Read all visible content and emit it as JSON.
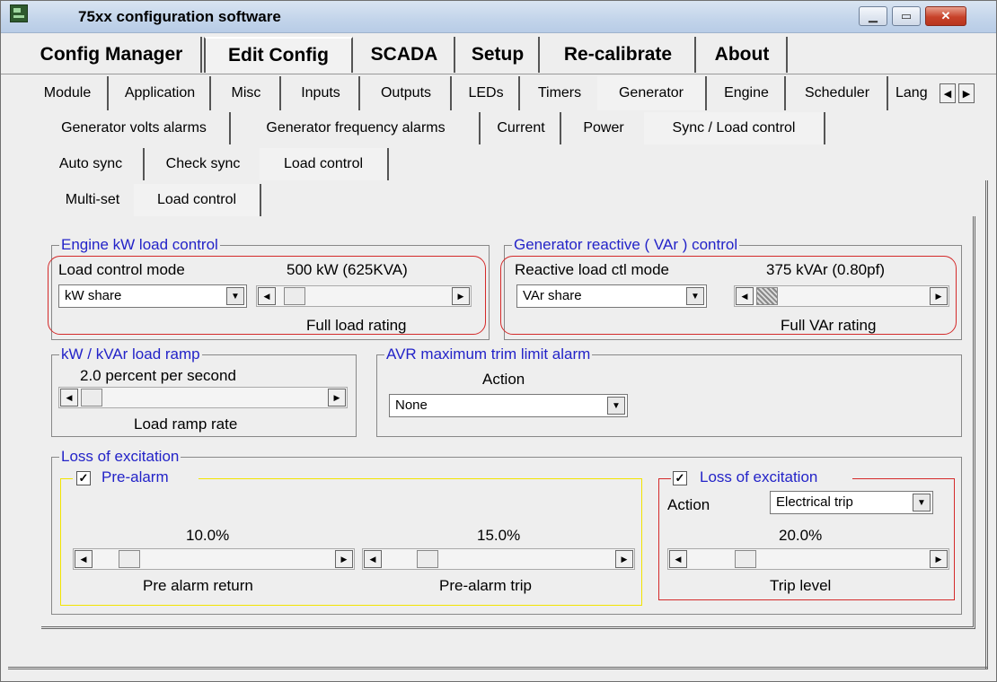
{
  "window": {
    "title": "75xx configuration software"
  },
  "tabs": {
    "main": [
      "Config Manager",
      "Edit Config",
      "SCADA",
      "Setup",
      "Re-calibrate",
      "About"
    ],
    "edit": [
      "Module",
      "Application",
      "Misc",
      "Inputs",
      "Outputs",
      "LEDs",
      "Timers",
      "Generator",
      "Engine",
      "Scheduler",
      "Lang"
    ],
    "generator": [
      "Generator volts alarms",
      "Generator frequency alarms",
      "Current",
      "Power",
      "Sync / Load control"
    ],
    "sync": [
      "Auto sync",
      "Check sync",
      "Load control"
    ],
    "load": [
      "Multi-set",
      "Load control"
    ]
  },
  "engine_kw": {
    "title": "Engine kW load control",
    "mode_label": "Load control mode",
    "mode_value": "kW share",
    "rating_value": "500 kW (625KVA)",
    "rating_caption": "Full load rating"
  },
  "gen_var": {
    "title": "Generator reactive ( VAr ) control",
    "mode_label": "Reactive load ctl mode",
    "mode_value": "VAr share",
    "rating_value": "375 kVAr (0.80pf)",
    "rating_caption": "Full VAr rating"
  },
  "ramp": {
    "title": "kW / kVAr load ramp",
    "value": "2.0 percent per second",
    "caption": "Load ramp rate"
  },
  "avr": {
    "title": "AVR maximum trim limit alarm",
    "action_label": "Action",
    "action_value": "None"
  },
  "loss": {
    "title": "Loss of excitation",
    "prealarm": {
      "title": "Pre-alarm",
      "checked": "✓",
      "return_value": "10.0%",
      "return_caption": "Pre alarm return",
      "trip_value": "15.0%",
      "trip_caption": "Pre-alarm trip"
    },
    "trip": {
      "title": "Loss of excitation",
      "checked": "✓",
      "action_label": "Action",
      "action_value": "Electrical trip",
      "level_value": "20.0%",
      "level_caption": "Trip level"
    }
  }
}
